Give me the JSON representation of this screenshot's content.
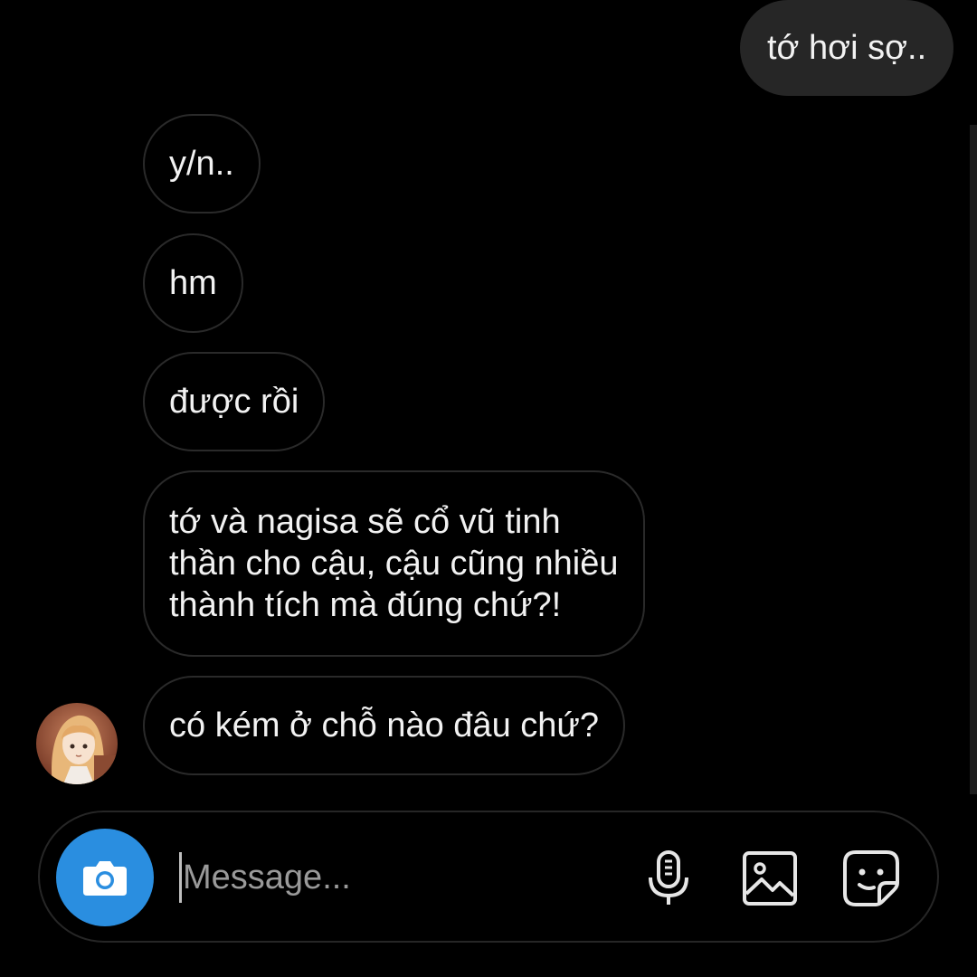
{
  "messages": [
    {
      "direction": "outgoing",
      "text": "tớ hơi sợ.."
    },
    {
      "direction": "incoming",
      "text": "y/n.."
    },
    {
      "direction": "incoming",
      "text": "hm"
    },
    {
      "direction": "incoming",
      "text": "được rồi"
    },
    {
      "direction": "incoming",
      "lines": [
        "tớ và nagisa sẽ cổ vũ tinh",
        "thần cho cậu, cậu cũng nhiều",
        "thành tích mà đúng chứ?!"
      ]
    },
    {
      "direction": "incoming",
      "text": "có kém ở chỗ nào đâu chứ?"
    }
  ],
  "composer": {
    "placeholder": "Message...",
    "value": "",
    "icons": [
      "camera-icon",
      "microphone-icon",
      "gallery-icon",
      "sticker-icon"
    ]
  },
  "colors": {
    "background": "#000000",
    "outgoing_bubble": "#262626",
    "incoming_border": "#2a2a2a",
    "camera_button": "#2a8ee0",
    "text": "#f2f2f2",
    "placeholder": "#9a9a9a"
  }
}
